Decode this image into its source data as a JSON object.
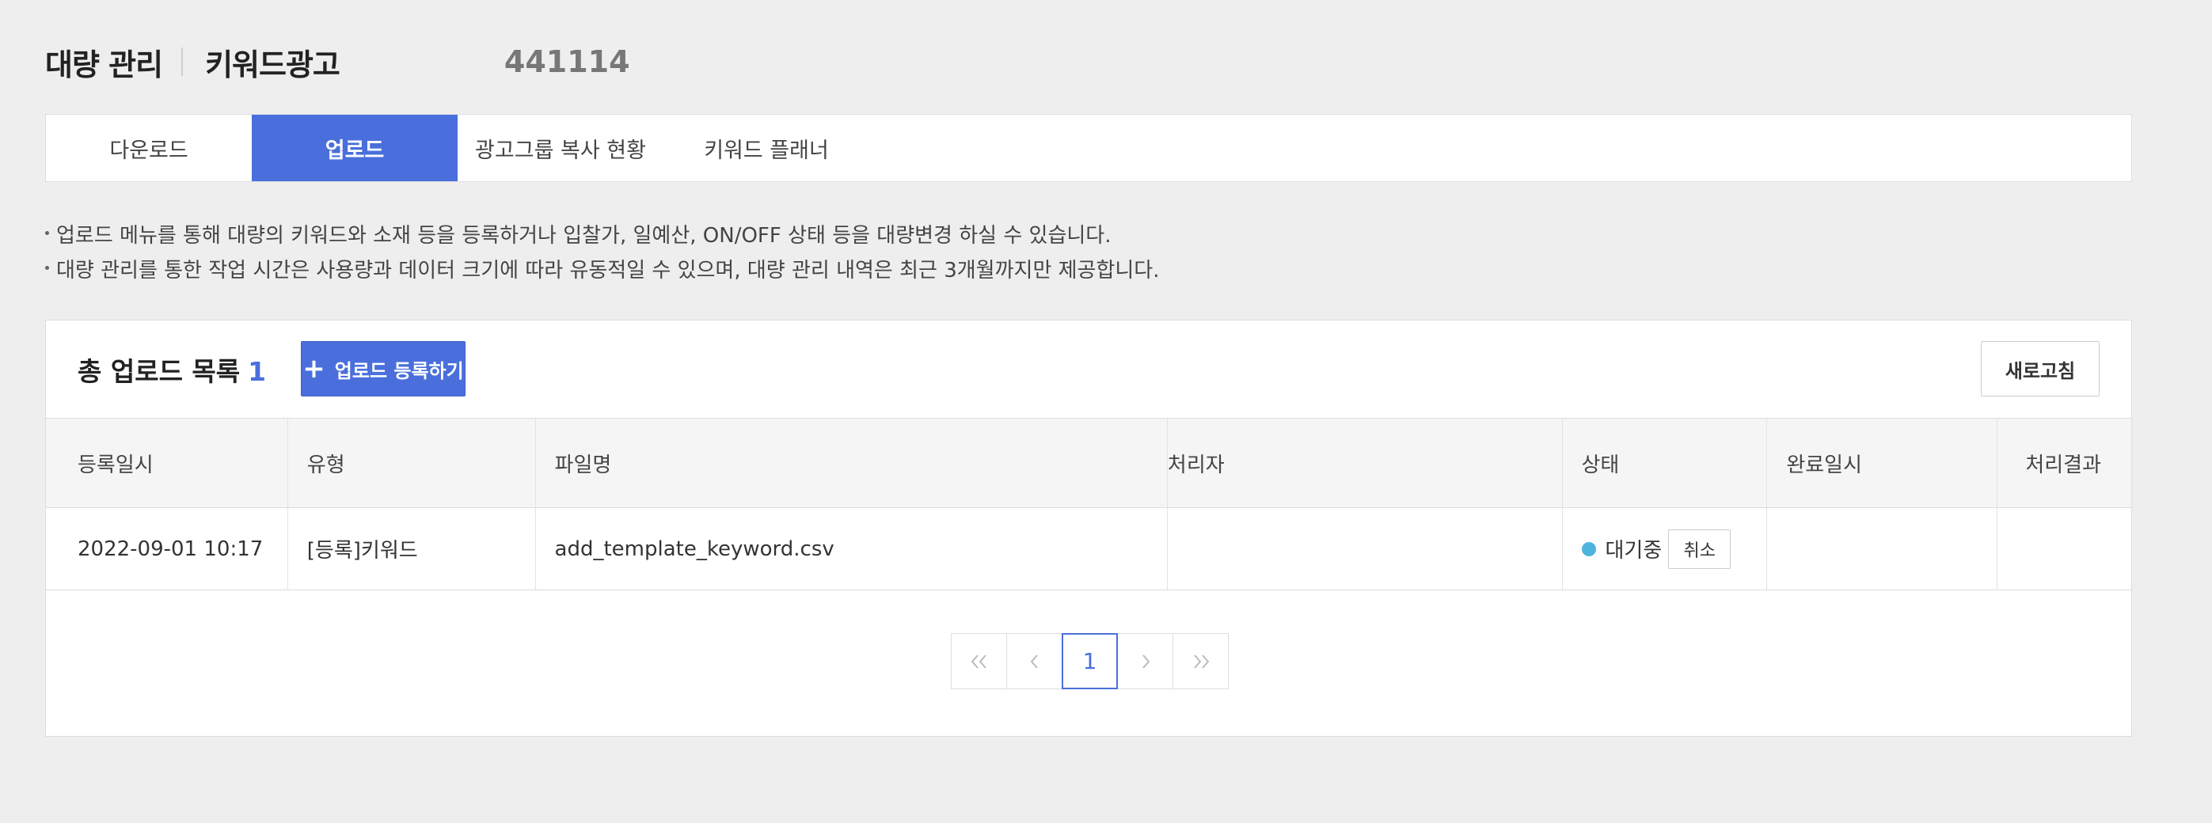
{
  "header": {
    "title": "대량 관리",
    "subtitle": "키워드광고",
    "account_id": "441114"
  },
  "tabs": [
    {
      "label": "다운로드",
      "active": false
    },
    {
      "label": "업로드",
      "active": true
    },
    {
      "label": "광고그룹 복사 현황",
      "active": false
    },
    {
      "label": "키워드 플래너",
      "active": false
    }
  ],
  "notices": [
    "업로드 메뉴를 통해 대량의 키워드와 소재 등을 등록하거나 입찰가, 일예산, ON/OFF 상태 등을 대량변경 하실 수 있습니다.",
    "대량 관리를 통한 작업 시간은 사용량과 데이터 크기에 따라 유동적일 수 있으며, 대량 관리 내역은 최근 3개월까지만 제공합니다."
  ],
  "list": {
    "title": "총 업로드 목록",
    "count": "1",
    "register_label": "업로드 등록하기",
    "refresh_label": "새로고침"
  },
  "table": {
    "columns": [
      "등록일시",
      "유형",
      "파일명",
      "처리자",
      "상태",
      "완료일시",
      "처리결과"
    ],
    "rows": [
      {
        "date": "2022-09-01 10:17",
        "type": "[등록]키워드",
        "filename": "add_template_keyword.csv",
        "handler": "",
        "status": "대기중",
        "status_color": "#4fb3e0",
        "cancel_label": "취소",
        "completed": "",
        "result": ""
      }
    ]
  },
  "pagination": {
    "current": "1",
    "icons": [
      "double-chevron-left-icon",
      "chevron-left-icon",
      "chevron-right-icon",
      "double-chevron-right-icon"
    ]
  },
  "colors": {
    "accent": "#4a6fdc",
    "background": "#eeeeee",
    "status_waiting": "#4fb3e0"
  }
}
